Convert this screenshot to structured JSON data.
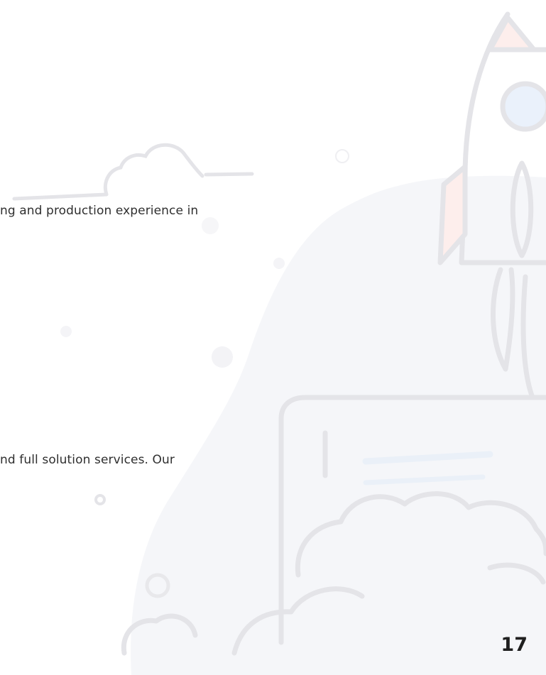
{
  "document": {
    "text_lines": [
      "ng and production experience in",
      "nd full solution services. Our"
    ],
    "page_number": "17"
  },
  "illustration": {
    "subject": "rocket-launch-over-laptop",
    "colors": {
      "line": "#e4e4e8",
      "blob": "#f5f6f9",
      "fin_tint": "#fdeeec",
      "window_tint": "#eaf1fb"
    }
  }
}
